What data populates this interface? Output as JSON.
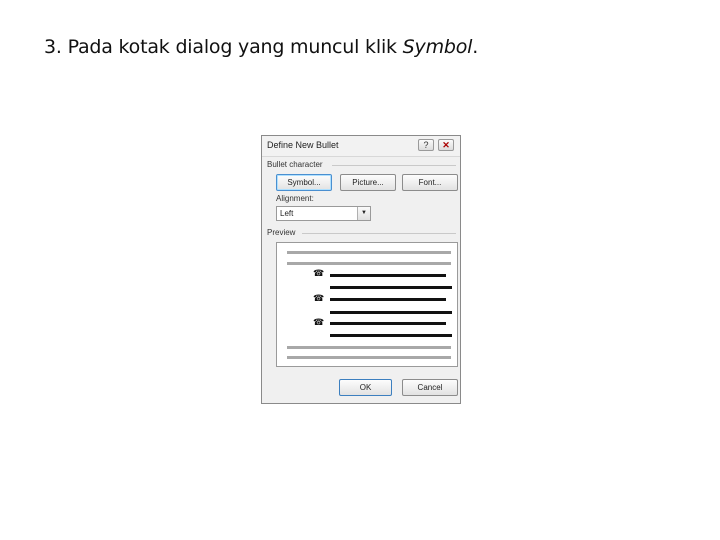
{
  "instruction": {
    "prefix": "3. Pada kotak dialog yang muncul klik ",
    "emphasis": "Symbol",
    "suffix": "."
  },
  "dialog": {
    "title": "Define New Bullet",
    "help_label": "?",
    "close_label": "✕",
    "bullet_character_label": "Bullet character",
    "buttons": {
      "symbol": "Symbol...",
      "picture": "Picture...",
      "font": "Font..."
    },
    "alignment_label": "Alignment:",
    "alignment_value": "Left",
    "preview_label": "Preview",
    "bullet_glyph": "☎",
    "ok_label": "OK",
    "cancel_label": "Cancel"
  },
  "colors": {
    "dialog_bg": "#f0f0f0",
    "active_border": "#4a8fd0",
    "preview_gray_line": "#a8a8a8",
    "preview_black_line": "#111111"
  },
  "icons": {
    "help": "question-mark-icon",
    "close": "close-icon",
    "dropdown": "chevron-down-icon",
    "bullet": "telephone-icon"
  }
}
